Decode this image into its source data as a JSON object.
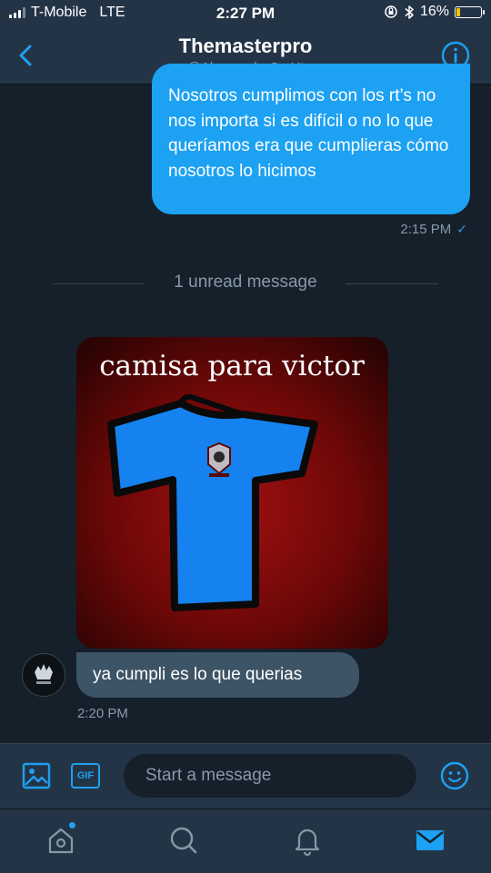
{
  "status_bar": {
    "carrier": "T-Mobile",
    "network": "LTE",
    "time": "2:27 PM",
    "battery": "16%",
    "battery_level": 0.16,
    "signal_bars": 3,
    "signal_bars_total": 4
  },
  "header": {
    "title": "Themasterpro",
    "handle": "@AlessandroCr_Yt"
  },
  "messages": {
    "sent_text": "Nosotros cumplimos con los rt’s no nos importa si es difícil o no lo que queríamos era que cumplieras cómo nosotros lo hicimos",
    "sent_time": "2:15 PM",
    "unread_divider": "1 unread message",
    "image_caption": "camisa para victor",
    "received_text": "ya cumpli es lo que querias",
    "received_time": "2:20 PM"
  },
  "composer": {
    "gif_label": "GIF",
    "placeholder": "Start a message"
  },
  "tabs": [
    "home-icon",
    "search-icon",
    "notifications-icon",
    "messages-icon"
  ],
  "colors": {
    "accent": "#1da1f2",
    "background": "#15202b",
    "bar": "#243447",
    "received_bubble": "#3d5466",
    "muted_text": "#8899a6",
    "battery_fill": "#f5c400"
  }
}
